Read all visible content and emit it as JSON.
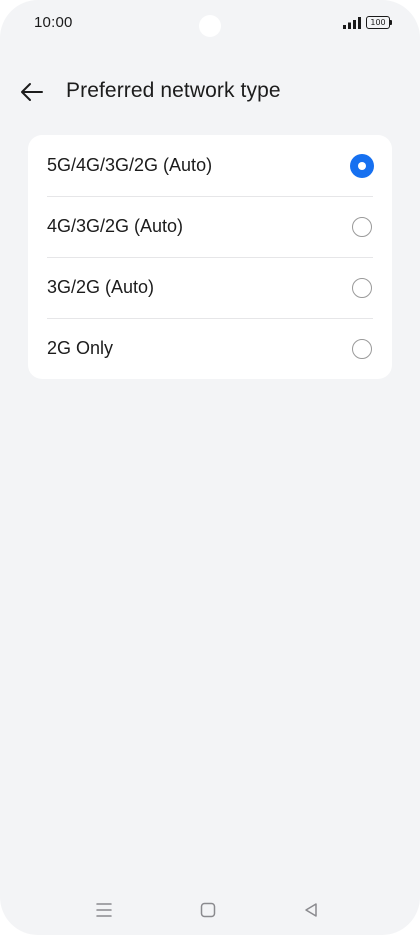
{
  "status_bar": {
    "time": "10:00",
    "battery": "100"
  },
  "header": {
    "title": "Preferred network type"
  },
  "options": [
    {
      "label": "5G/4G/3G/2G (Auto)",
      "selected": true
    },
    {
      "label": "4G/3G/2G (Auto)",
      "selected": false
    },
    {
      "label": "3G/2G (Auto)",
      "selected": false
    },
    {
      "label": "2G Only",
      "selected": false
    }
  ],
  "colors": {
    "accent": "#1670f0",
    "background": "#f3f4f6",
    "card": "#ffffff"
  },
  "icons": {
    "back": "arrow-left-icon",
    "signal": "signal-icon",
    "battery": "battery-icon",
    "nav_menu": "menu-icon",
    "nav_home": "home-icon",
    "nav_back": "back-triangle-icon"
  }
}
